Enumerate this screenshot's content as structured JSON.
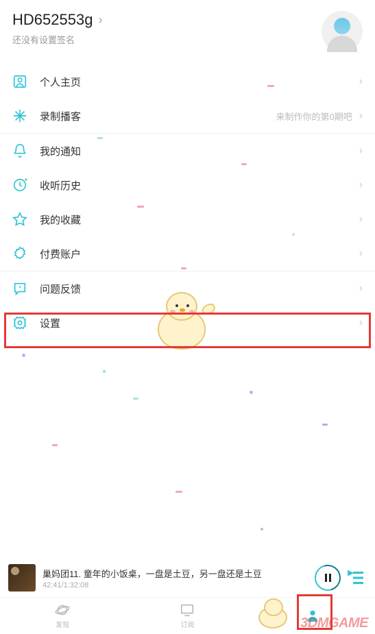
{
  "header": {
    "username": "HD652553g",
    "signature": "还没有设置签名"
  },
  "menu": {
    "profile": "个人主页",
    "record": "录制播客",
    "record_hint": "来制作你的第0期吧",
    "notify": "我的通知",
    "history": "收听历史",
    "fav": "我的收藏",
    "paid": "付费账户",
    "feedback": "问题反馈",
    "settings": "设置"
  },
  "player": {
    "title": "巢妈团11. 童年的小饭桌，一盘是土豆，另一盘还是土豆",
    "time": "42:41/1:32:08"
  },
  "tabs": {
    "discover": "发现",
    "subscribe": "订阅",
    "mine": ""
  },
  "watermark": "3DMGAME"
}
